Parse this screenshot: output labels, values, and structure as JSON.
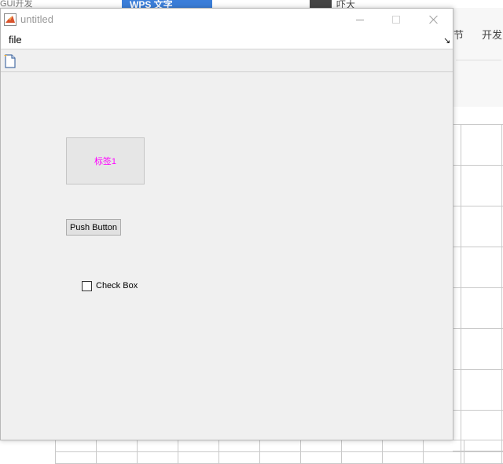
{
  "background": {
    "top_left_text": "GUI开发",
    "tab_label": "WPS 文字",
    "avatar_text": "吓大",
    "ribbon": {
      "left_label": "节",
      "right_label": "开发"
    },
    "accent_color": "#3b7ed9"
  },
  "window": {
    "title": "untitled",
    "app_icon": "matlab-icon",
    "controls": {
      "minimize": "minimize-icon",
      "maximize": "maximize-icon",
      "close": "close-icon"
    }
  },
  "menubar": {
    "items": [
      {
        "label": "file"
      }
    ],
    "overflow_icon": "expand-arrow-icon"
  },
  "toolbar": {
    "items": [
      {
        "icon": "new-document-icon"
      }
    ]
  },
  "components": {
    "static_text": {
      "label": "标签1",
      "color": "#ff00ff"
    },
    "push_button": {
      "label": "Push Button"
    },
    "checkbox": {
      "label": "Check Box",
      "checked": false
    }
  }
}
